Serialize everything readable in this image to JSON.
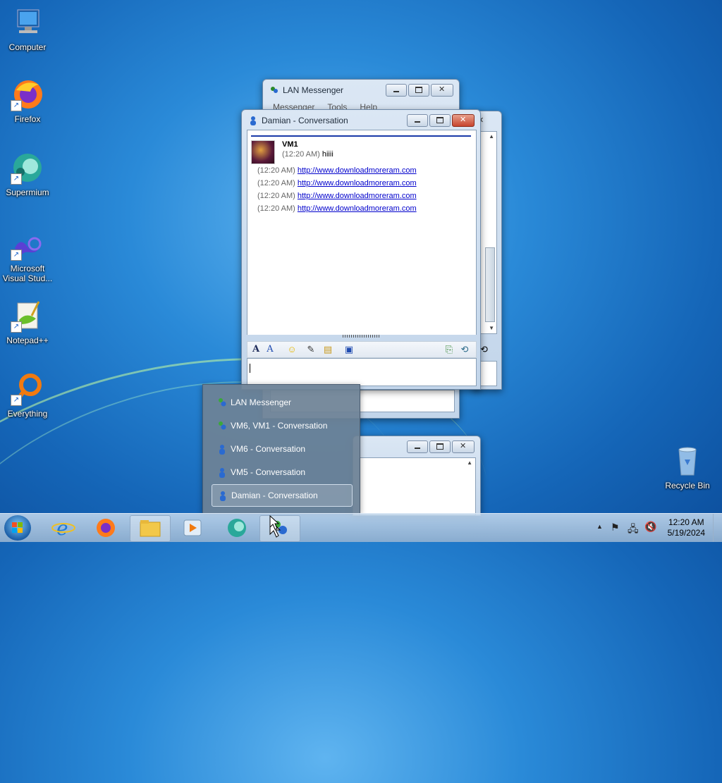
{
  "desktop": {
    "icons": [
      {
        "label": "Computer"
      },
      {
        "label": "Firefox"
      },
      {
        "label": "Supermium"
      },
      {
        "label_line1": "Microsoft",
        "label_line2": "Visual Stud..."
      },
      {
        "label": "Notepad++"
      },
      {
        "label": "Everything"
      },
      {
        "label": "Recycle Bin"
      }
    ]
  },
  "lan_window": {
    "title": "LAN Messenger",
    "menu": [
      "Messenger",
      "Tools",
      "Help"
    ]
  },
  "conversation": {
    "title": "Damian - Conversation",
    "sender": "VM1",
    "first_time": "(12:20 AM)",
    "first_text": "hiiii",
    "lines": [
      {
        "time": "(12:20 AM)",
        "link": "http://www.downloadmoreram.com"
      },
      {
        "time": "(12:20 AM)",
        "link": "http://www.downloadmoreram.com"
      },
      {
        "time": "(12:20 AM)",
        "link": "http://www.downloadmoreram.com"
      },
      {
        "time": "(12:20 AM)",
        "link": "http://www.downloadmoreram.com"
      }
    ],
    "input_value": ""
  },
  "jump_list": {
    "items": [
      {
        "label": "LAN Messenger"
      },
      {
        "label": "VM6, VM1 - Conversation"
      },
      {
        "label": "VM6 - Conversation"
      },
      {
        "label": "VM5 - Conversation"
      },
      {
        "label": "Damian - Conversation"
      }
    ],
    "selected_index": 4
  },
  "taskbar": {
    "time": "12:20 AM",
    "date": "5/19/2024"
  },
  "colors": {
    "accent": "#1a3aa8",
    "link": "#0000cc",
    "close_button": "#c7452e"
  }
}
